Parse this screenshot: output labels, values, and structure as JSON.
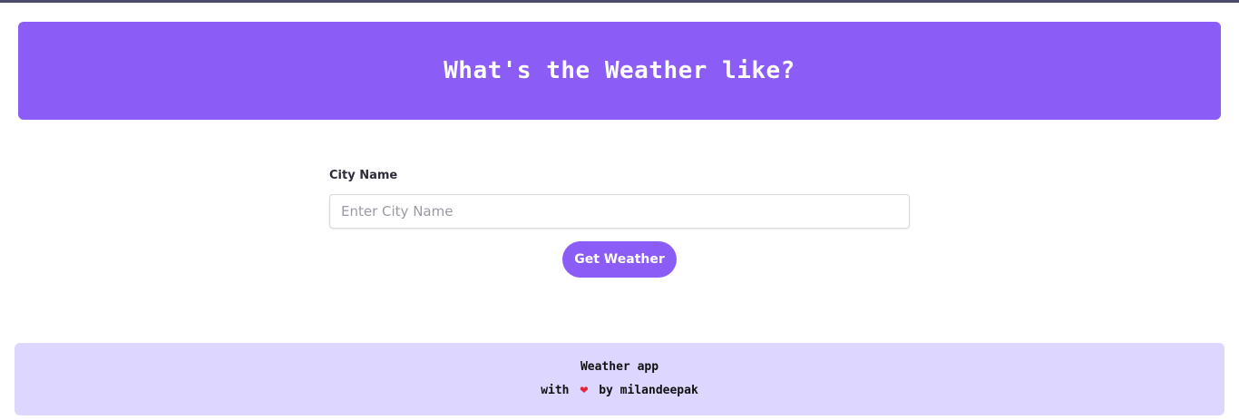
{
  "header": {
    "title": "What's the Weather like?"
  },
  "form": {
    "label": "City Name",
    "placeholder": "Enter City Name",
    "value": "",
    "button_label": "Get Weather"
  },
  "footer": {
    "line1": "Weather app",
    "with_text": "with",
    "heart_icon": "heart-icon",
    "by_text": "by milandeepak"
  },
  "colors": {
    "accent": "#8b5cf6",
    "footer_bg": "#ddd6fe",
    "heart": "#e0263c"
  }
}
